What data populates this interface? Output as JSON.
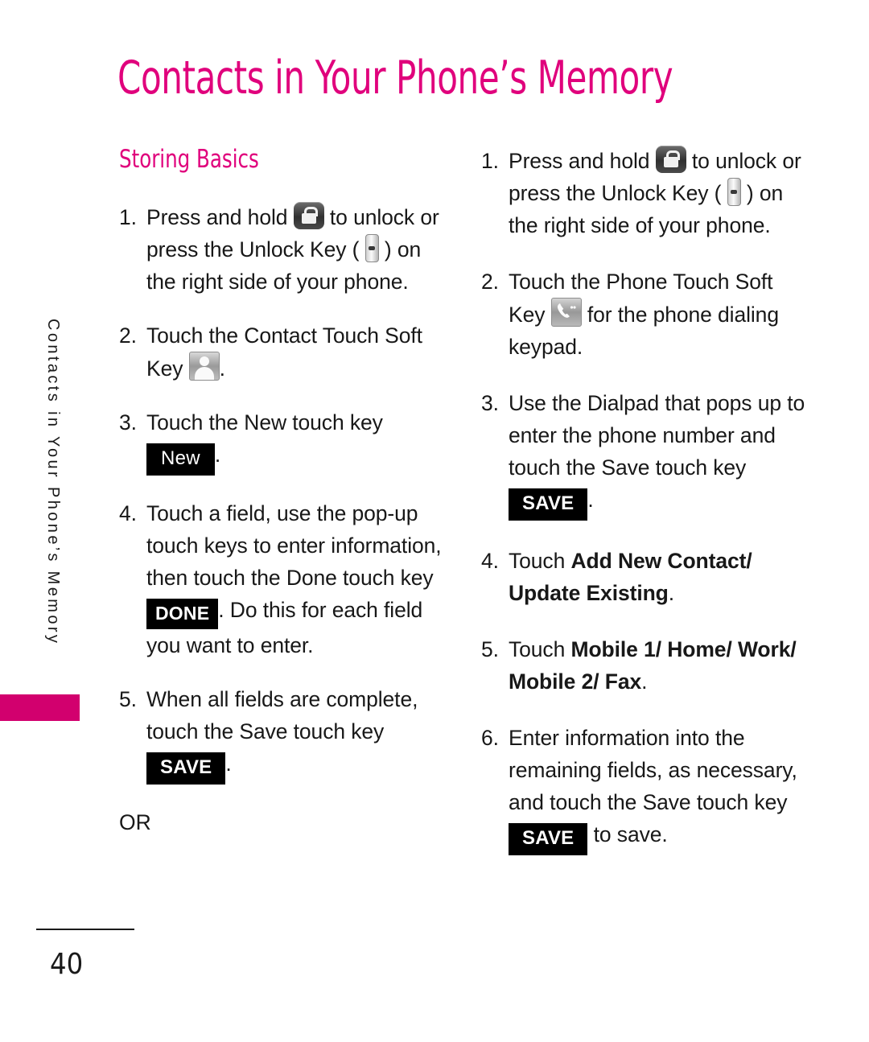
{
  "page": {
    "title": "Contacts in Your Phone’s Memory",
    "side_running_head": "Contacts in Your Phone’s Memory",
    "page_number": "40",
    "accent_color": "#e0007c",
    "tab_color": "#d2006e"
  },
  "left_column": {
    "section_heading": "Storing Basics",
    "steps": [
      {
        "number": "1.",
        "part1": "Press and hold ",
        "icon1": "lock-icon",
        "part2": " to unlock or press the Unlock Key ( ",
        "icon2": "side-unlock-key-icon",
        "part3": " ) on the right side of your phone."
      },
      {
        "number": "2.",
        "part1": "Touch the Contact Touch Soft Key ",
        "icon1": "contact-icon",
        "part2": "."
      },
      {
        "number": "3.",
        "part1": "Touch the New touch key ",
        "badge": "New",
        "part2": "."
      },
      {
        "number": "4.",
        "part1": "Touch a field, use the pop-up touch keys to enter information, then touch the Done touch key ",
        "badge": "DONE",
        "part2": ". Do this for each field you want to enter."
      },
      {
        "number": "5.",
        "part1": "When all fields are complete, touch the Save touch key ",
        "badge": "SAVE",
        "part2": "."
      }
    ],
    "or_label": "OR"
  },
  "right_column": {
    "steps": [
      {
        "number": "1.",
        "part1": "Press and hold ",
        "icon1": "lock-icon",
        "part2": " to unlock or press the Unlock Key ( ",
        "icon2": "side-unlock-key-icon",
        "part3": " ) on the right side of your phone."
      },
      {
        "number": "2.",
        "part1": "Touch the Phone Touch Soft Key ",
        "icon1": "phone-handset-icon",
        "part2": " for the phone dialing keypad."
      },
      {
        "number": "3.",
        "part1": "Use the Dialpad that pops up to enter the phone number and touch the Save touch key ",
        "badge": "SAVE",
        "part2": "."
      },
      {
        "number": "4.",
        "part1": "Touch ",
        "bold": "Add New Contact/ Update Existing",
        "part2": "."
      },
      {
        "number": "5.",
        "part1": "Touch ",
        "bold": "Mobile 1/ Home/ Work/ Mobile 2/ Fax",
        "part2": "."
      },
      {
        "number": "6.",
        "part1": "Enter information into the remaining fields, as necessary, and touch the Save touch key ",
        "badge": "SAVE",
        "part2": " to save."
      }
    ]
  }
}
